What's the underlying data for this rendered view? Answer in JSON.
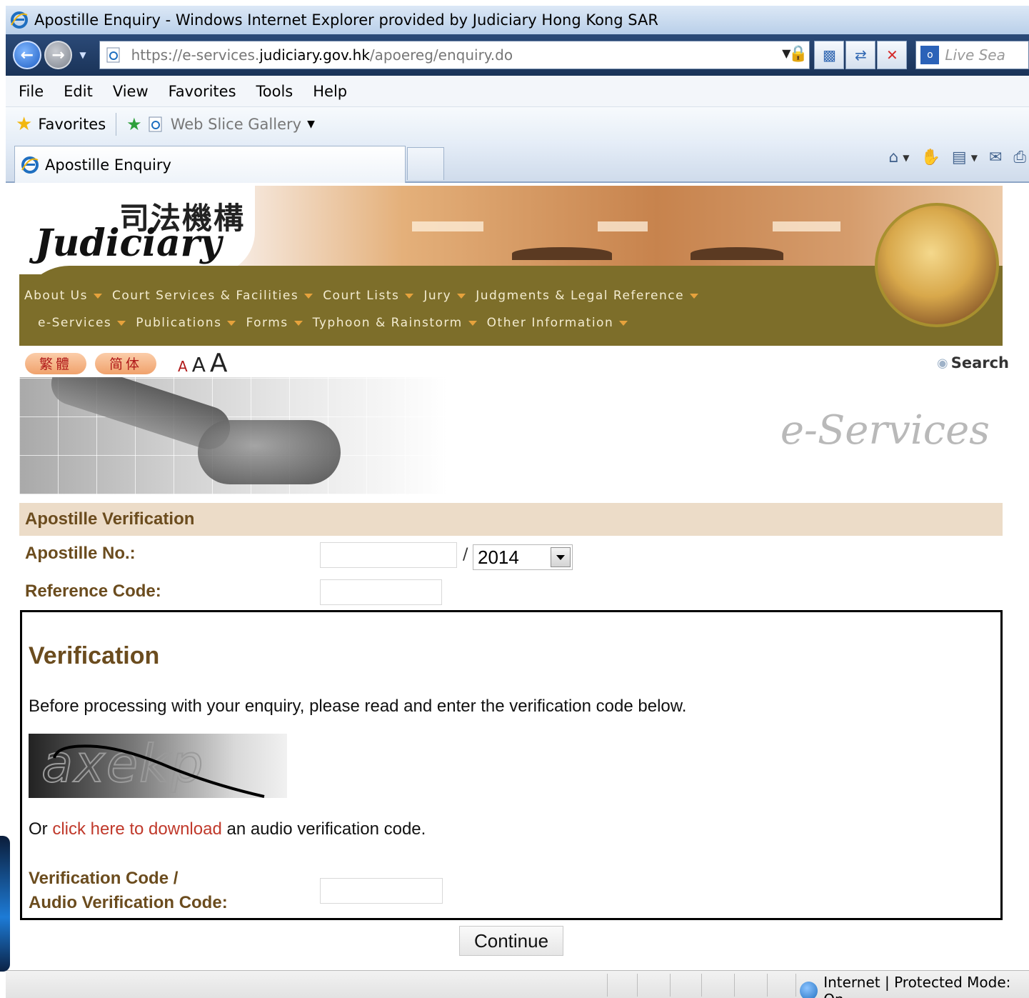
{
  "window": {
    "title": "Apostille Enquiry - Windows Internet Explorer provided by Judiciary Hong Kong SAR"
  },
  "address": {
    "url_scheme": "https://",
    "url_sub": "e-services.",
    "url_host": "judiciary.gov.hk",
    "url_path": "/apoereg/enquiry.do",
    "live_search_placeholder": "Live Sea"
  },
  "menu": [
    "File",
    "Edit",
    "View",
    "Favorites",
    "Tools",
    "Help"
  ],
  "favorites": {
    "label": "Favorites",
    "web_slice_gallery": "Web Slice Gallery"
  },
  "tab": {
    "title": "Apostille Enquiry"
  },
  "site": {
    "logo_cn": "司法機構",
    "logo_en": "Judiciary",
    "nav_row1": [
      "About Us",
      "Court Services & Facilities",
      "Court Lists",
      "Jury",
      "Judgments & Legal Reference"
    ],
    "nav_row2": [
      "e-Services",
      "Publications",
      "Forms",
      "Typhoon & Rainstorm",
      "Other Information"
    ],
    "lang_trad": "繁體",
    "lang_simp": "简体",
    "font_small": "A",
    "font_medium": "A",
    "font_large": "A",
    "search_label": "Search",
    "eservices_logo": "e-Services"
  },
  "form": {
    "section_title": "Apostille Verification",
    "apostille_no_label": "Apostille No.:",
    "apostille_no_value": "",
    "slash": "/",
    "year_selected": "2014",
    "reference_code_label": "Reference Code:",
    "reference_code_value": ""
  },
  "verification": {
    "title": "Verification",
    "instruction": "Before processing with your enquiry, please read and enter the verification code below.",
    "captcha_text": "axekp",
    "audio_prefix": "Or ",
    "audio_link": "click here to download",
    "audio_suffix": " an audio verification code.",
    "code_label_line1": "Verification Code /",
    "code_label_line2": "Audio Verification Code:",
    "code_value": ""
  },
  "actions": {
    "continue_label": "Continue"
  },
  "status": {
    "zone": "Internet | Protected Mode: On"
  },
  "colors": {
    "brand_olive": "#7d6e2a",
    "label_brown": "#6b4c1e",
    "section_bg": "#ecdcc8",
    "link_red": "#c0392b"
  }
}
